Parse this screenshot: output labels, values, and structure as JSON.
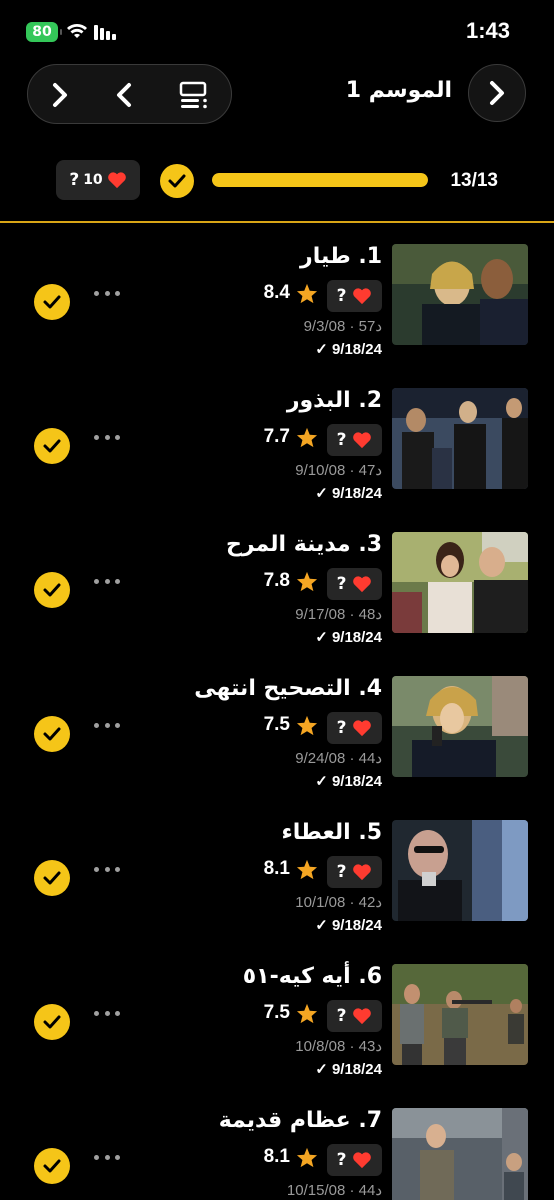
{
  "status_bar": {
    "battery": "80",
    "time": "1:43"
  },
  "header": {
    "season_title": "الموسم 1"
  },
  "progress": {
    "text": "13/13",
    "fraction": 1.0,
    "rating_chip_value": "10",
    "rating_chip_unknown": "?"
  },
  "colors": {
    "accent": "#f5c518",
    "heart": "#ff3b30",
    "background": "#000000"
  },
  "episodes": [
    {
      "title": "1. طيار",
      "rating": "8.4",
      "user_rating": "?",
      "air": "9/3/08 · 57د",
      "watched": "✓ 9/18/24"
    },
    {
      "title": "2. البذور",
      "rating": "7.7",
      "user_rating": "?",
      "air": "9/10/08 · 47د",
      "watched": "✓ 9/18/24"
    },
    {
      "title": "3. مدينة المرح",
      "rating": "7.8",
      "user_rating": "?",
      "air": "9/17/08 · 48د",
      "watched": "✓ 9/18/24"
    },
    {
      "title": "4. التصحيح انتهى",
      "rating": "7.5",
      "user_rating": "?",
      "air": "9/24/08 · 44د",
      "watched": "✓ 9/18/24"
    },
    {
      "title": "5. العطاء",
      "rating": "8.1",
      "user_rating": "?",
      "air": "10/1/08 · 42د",
      "watched": "✓ 9/18/24"
    },
    {
      "title": "6. أيه كيه-٥١",
      "rating": "7.5",
      "user_rating": "?",
      "air": "10/8/08 · 43د",
      "watched": "✓ 9/18/24"
    },
    {
      "title": "7. عظام قديمة",
      "rating": "8.1",
      "user_rating": "?",
      "air": "10/15/08 · 44د",
      "watched": ""
    }
  ]
}
